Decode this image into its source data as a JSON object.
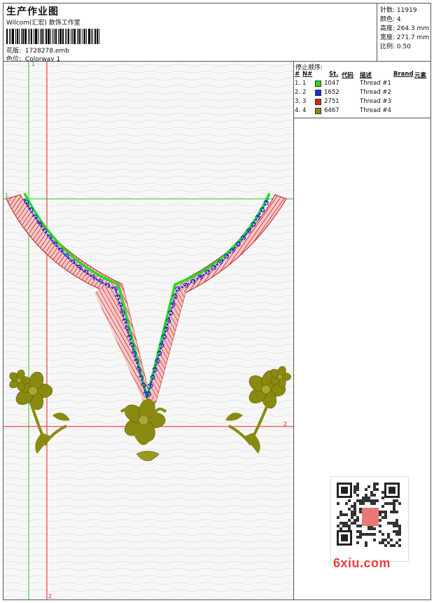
{
  "header": {
    "title": "生产作业图",
    "company": "Wilcom(汇宏) 数饰工作室",
    "design_label": "花版:",
    "design_value": "1728278.emb",
    "colorway_label": "色位:",
    "colorway_value": "Colorway 1"
  },
  "stats": [
    {
      "label": "针数:",
      "value": "11919"
    },
    {
      "label": "颜色:",
      "value": "4"
    },
    {
      "label": "高度:",
      "value": "264.3 mm"
    },
    {
      "label": "宽度:",
      "value": "271.7 mm"
    },
    {
      "label": "比例:",
      "value": "0.50"
    }
  ],
  "stop_sequence": {
    "title": "停止顺序:",
    "columns": [
      "#",
      "N#",
      "St.",
      "代码",
      "描述",
      "Brand",
      "元素"
    ],
    "rows": [
      {
        "num": "1.",
        "n": "1",
        "code": "1047",
        "desc": "Thread #1",
        "color": "#22dd22"
      },
      {
        "num": "2.",
        "n": "2",
        "code": "1652",
        "desc": "Thread #2",
        "color": "#1a2ad8"
      },
      {
        "num": "3.",
        "n": "3",
        "code": "2751",
        "desc": "Thread #3",
        "color": "#e02020"
      },
      {
        "num": "4.",
        "n": "4",
        "code": "6467",
        "desc": "Thread #4",
        "color": "#8a8a10"
      }
    ]
  },
  "guides": {
    "label_1": "1",
    "label_2": "2"
  },
  "watermark": {
    "site": "6xiu.com"
  },
  "colors": {
    "green": "#22dd22",
    "blue": "#1a2ad8",
    "red": "#e02020",
    "olive": "#8a8a10",
    "guide_red": "#e02020",
    "guide_green": "#22cc22"
  }
}
